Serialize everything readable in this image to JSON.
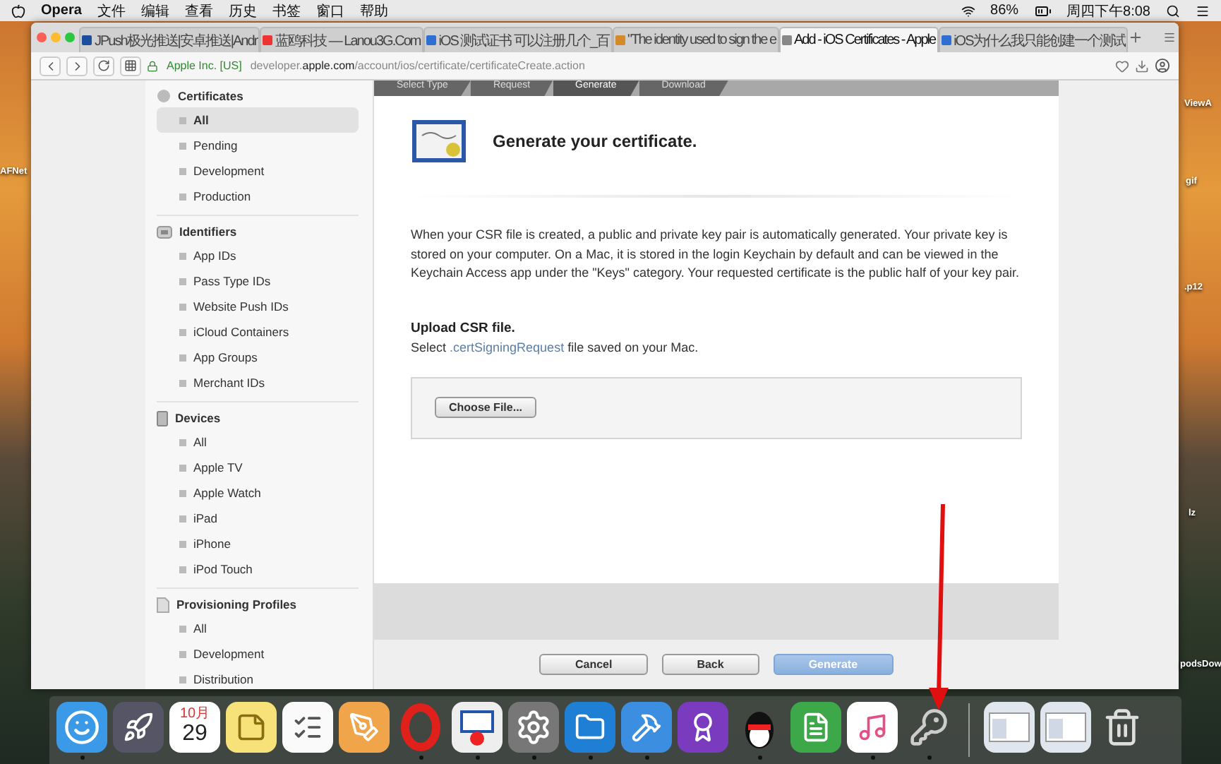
{
  "menubar": {
    "app": "Opera",
    "menus": [
      "文件",
      "编辑",
      "查看",
      "历史",
      "书签",
      "窗口",
      "帮助"
    ],
    "battery": "86%",
    "clock": "周四下午8:08"
  },
  "desktop_labels": [
    "AFNet",
    "ViewA",
    "gif",
    ".p12",
    "lz",
    "podsDow"
  ],
  "browser": {
    "tabs": [
      {
        "title": "JPush极光推送|安卓推送|Andr",
        "selected": false
      },
      {
        "title": "蓝鸥科技 — Lanou3G.Com",
        "selected": false
      },
      {
        "title": "iOS 测试证书 可以注册几个_百",
        "selected": false
      },
      {
        "title": "\"The identity used to sign the e",
        "selected": false
      },
      {
        "title": "Add - iOS Certificates - Apple",
        "selected": true
      },
      {
        "title": "iOS为什么我只能创建一个测试",
        "selected": false
      }
    ],
    "site": "Apple Inc. [US]",
    "url": "developer.**apple.com**/account/ios/certificate/certificateCreate.action"
  },
  "sidebar": [
    {
      "title": "Certificates",
      "kind": "certificates",
      "items": [
        {
          "label": "All",
          "selected": true
        },
        {
          "label": "Pending",
          "selected": false
        },
        {
          "label": "Development",
          "selected": false
        },
        {
          "label": "Production",
          "selected": false
        }
      ]
    },
    {
      "title": "Identifiers",
      "kind": "identifiers",
      "items": [
        {
          "label": "App IDs",
          "selected": false
        },
        {
          "label": "Pass Type IDs",
          "selected": false
        },
        {
          "label": "Website Push IDs",
          "selected": false
        },
        {
          "label": "iCloud Containers",
          "selected": false
        },
        {
          "label": "App Groups",
          "selected": false
        },
        {
          "label": "Merchant IDs",
          "selected": false
        }
      ]
    },
    {
      "title": "Devices",
      "kind": "devices",
      "items": [
        {
          "label": "All",
          "selected": false
        },
        {
          "label": "Apple TV",
          "selected": false
        },
        {
          "label": "Apple Watch",
          "selected": false
        },
        {
          "label": "iPad",
          "selected": false
        },
        {
          "label": "iPhone",
          "selected": false
        },
        {
          "label": "iPod Touch",
          "selected": false
        }
      ]
    },
    {
      "title": "Provisioning Profiles",
      "kind": "profiles",
      "items": [
        {
          "label": "All",
          "selected": false
        },
        {
          "label": "Development",
          "selected": false
        },
        {
          "label": "Distribution",
          "selected": false
        }
      ]
    }
  ],
  "steps": [
    {
      "label": "Select Type",
      "selected": false
    },
    {
      "label": "Request",
      "selected": false
    },
    {
      "label": "Generate",
      "selected": true
    },
    {
      "label": "Download",
      "selected": false
    }
  ],
  "heading": "Generate your certificate.",
  "description": "When your CSR file is created, a public and private key pair is automatically generated. Your private key is stored on your computer. On a Mac, it is stored in the login Keychain by default and can be viewed in the Keychain Access app under the \"Keys\" category. Your requested certificate is the public half of your key pair.",
  "upload_title": "Upload CSR file.",
  "upload_hint": {
    "prefix": "Select ",
    "link": ".certSigningRequest",
    "suffix": " file saved on your Mac."
  },
  "choose_file": "Choose File...",
  "buttons": [
    {
      "label": "Cancel",
      "kind": "default"
    },
    {
      "label": "Back",
      "kind": "default"
    },
    {
      "label": "Generate",
      "kind": "primary"
    }
  ],
  "dock": [
    {
      "kind": "finder",
      "running": true
    },
    {
      "kind": "launchpad",
      "running": false
    },
    {
      "kind": "calendar",
      "running": false,
      "month": "10月",
      "day": "29"
    },
    {
      "kind": "notes",
      "running": false
    },
    {
      "kind": "reminders",
      "running": false
    },
    {
      "kind": "pages",
      "running": false
    },
    {
      "kind": "opera",
      "running": true
    },
    {
      "kind": "preview",
      "running": true
    },
    {
      "kind": "settings",
      "running": true
    },
    {
      "kind": "word",
      "running": true
    },
    {
      "kind": "xcode",
      "running": true
    },
    {
      "kind": "dash",
      "running": false
    },
    {
      "kind": "qq",
      "running": true
    },
    {
      "kind": "evernote",
      "running": false
    },
    {
      "kind": "itunes",
      "running": true
    },
    {
      "kind": "keychain",
      "running": true
    },
    {
      "kind": "separator"
    },
    {
      "kind": "window",
      "running": false
    },
    {
      "kind": "window",
      "running": false
    },
    {
      "kind": "trash",
      "running": false
    }
  ]
}
